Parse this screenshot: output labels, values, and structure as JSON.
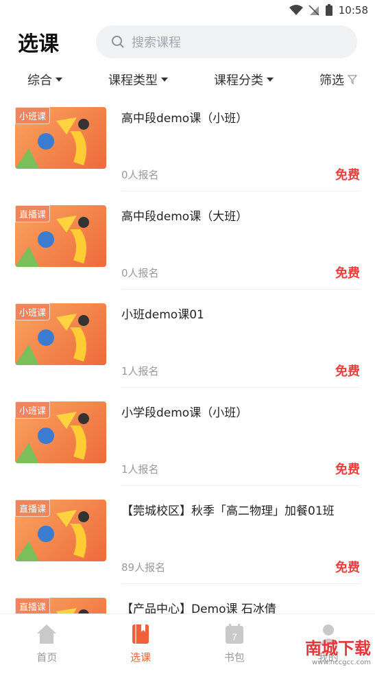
{
  "status": {
    "time": "10:58"
  },
  "header": {
    "title": "选课",
    "search_placeholder": "搜索课程"
  },
  "filters": [
    "综合",
    "课程类型",
    "课程分类",
    "筛选"
  ],
  "courses": [
    {
      "badge": "小班课",
      "title": "高中段demo课（小班）",
      "count": "0人报名",
      "price": "免费"
    },
    {
      "badge": "直播课",
      "title": "高中段demo课（大班）",
      "count": "0人报名",
      "price": "免费"
    },
    {
      "badge": "小班课",
      "title": "小班demo课01",
      "count": "1人报名",
      "price": "免费"
    },
    {
      "badge": "小班课",
      "title": "小学段demo课（小班）",
      "count": "1人报名",
      "price": "免费"
    },
    {
      "badge": "直播课",
      "title": "【莞城校区】秋季「高二物理」加餐01班",
      "count": "89人报名",
      "price": "免费"
    },
    {
      "badge": "直播课",
      "title": "【产品中心】Demo课 石冰倩",
      "count": "",
      "price": ""
    }
  ],
  "tabs": [
    {
      "label": "首页",
      "icon": "home-icon"
    },
    {
      "label": "选课",
      "icon": "courses-icon"
    },
    {
      "label": "书包",
      "icon": "calendar-icon",
      "icon_text": "7"
    },
    {
      "label": "我的",
      "icon": "user-icon"
    }
  ],
  "watermark": {
    "text": "南城下载",
    "url": "www.nccgcc.com"
  },
  "colors": {
    "accent": "#f0603a",
    "price": "#f03c3c"
  }
}
